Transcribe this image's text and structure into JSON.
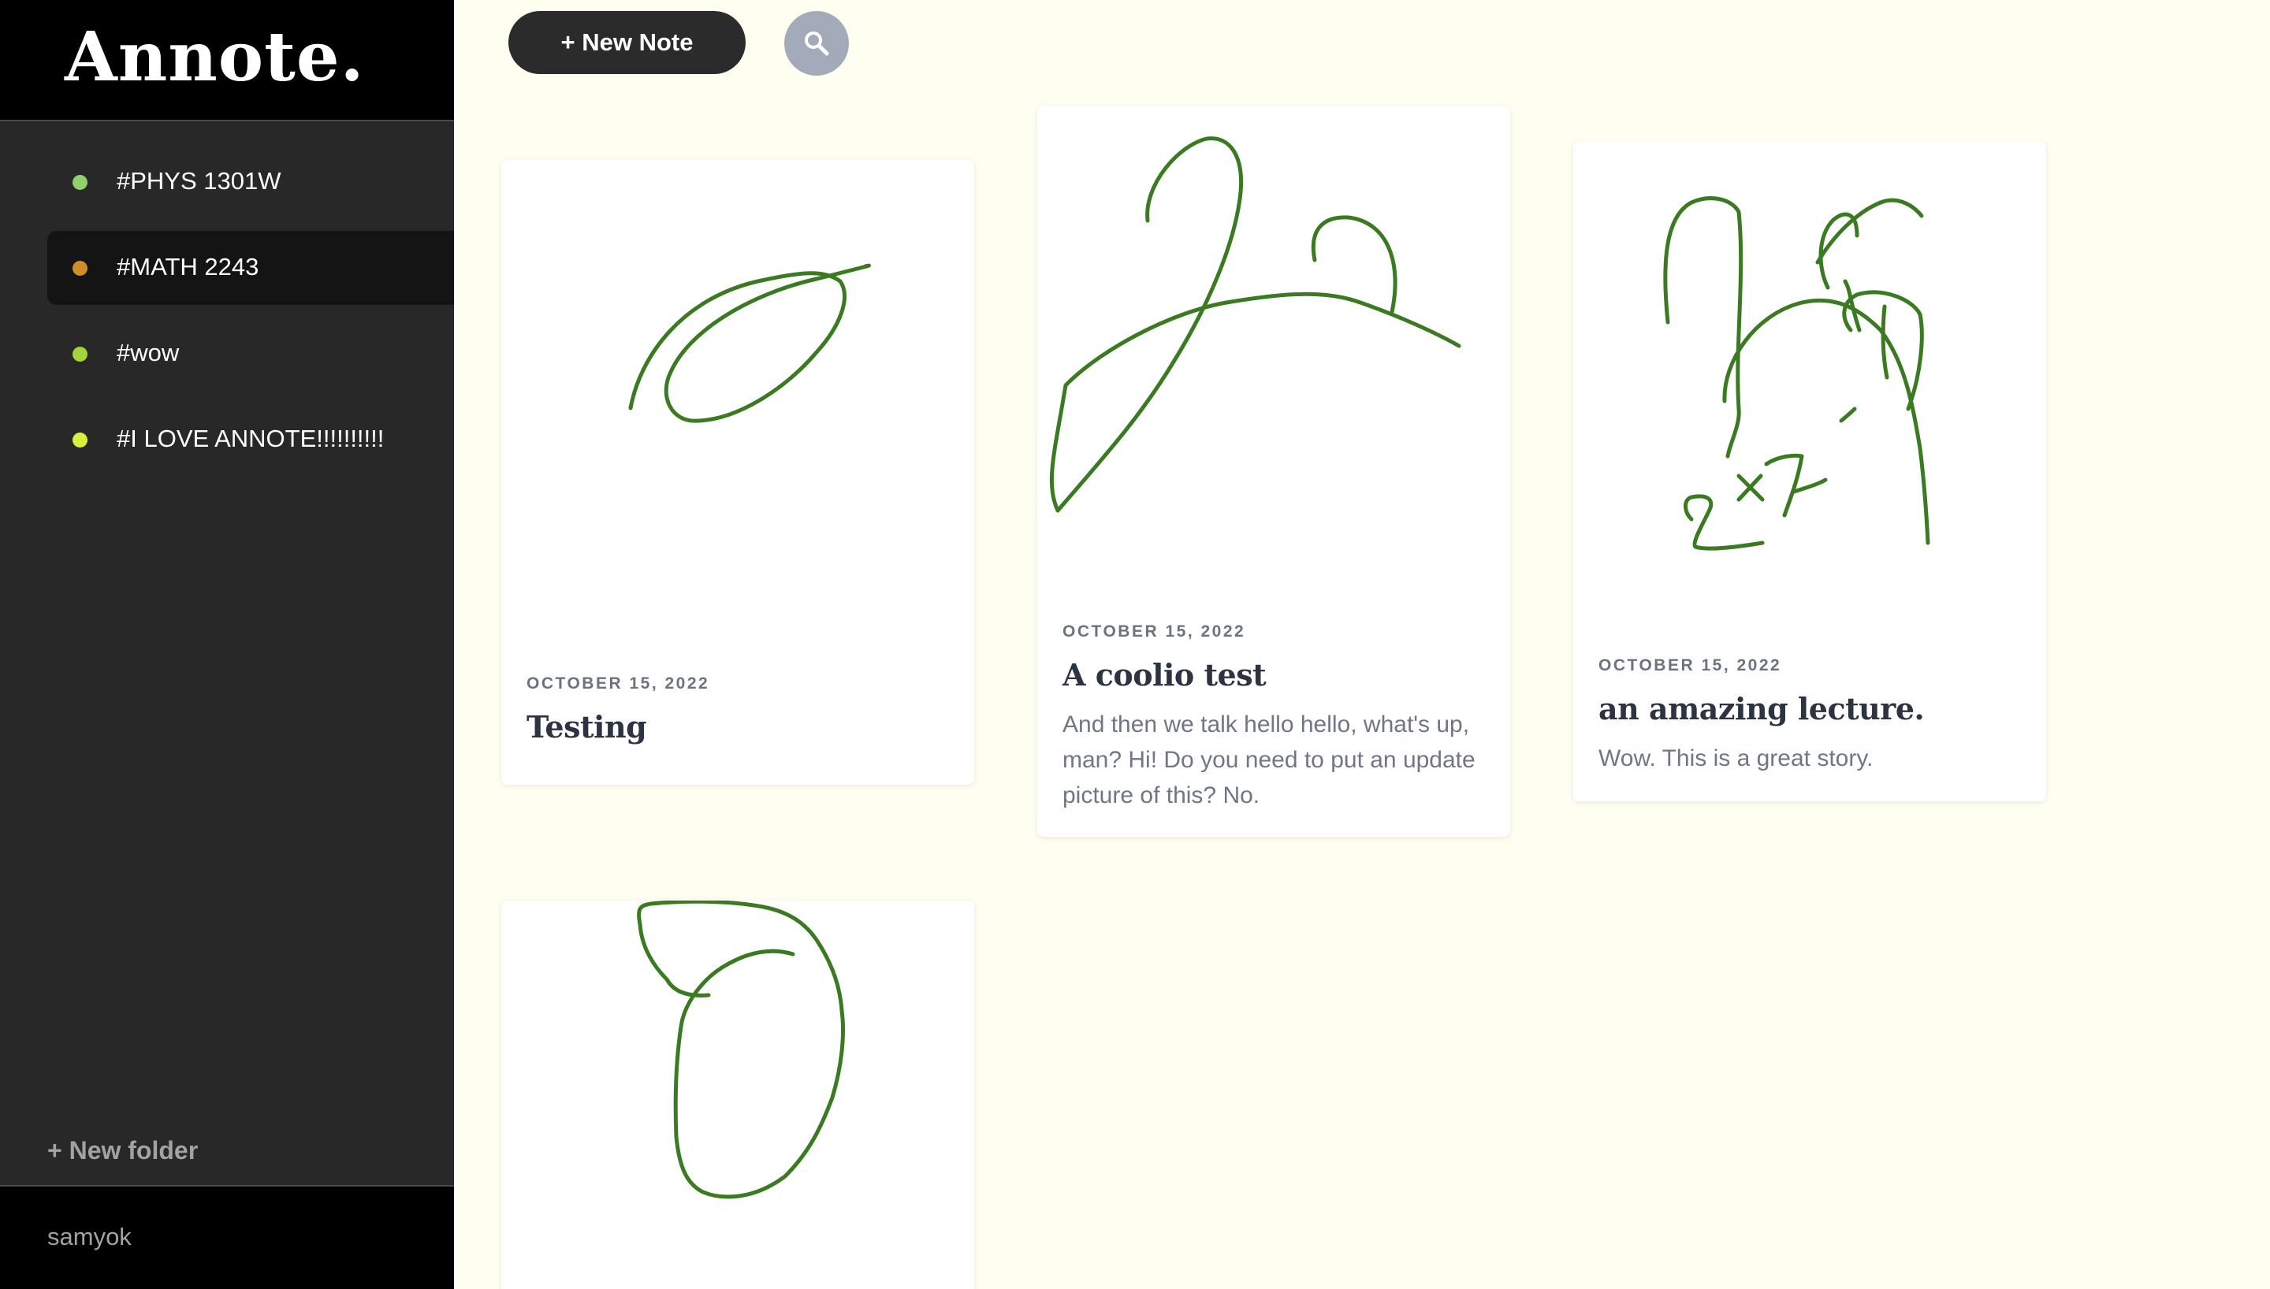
{
  "app": {
    "brand": "Annote.",
    "new_note_label": "+ New Note",
    "search_icon": "search-icon"
  },
  "sidebar": {
    "folders": [
      {
        "label": "#PHYS 1301W",
        "color": "#8fd26a",
        "active": false
      },
      {
        "label": "#MATH 2243",
        "color": "#cf8d28",
        "active": true
      },
      {
        "label": "#wow",
        "color": "#a3d43a",
        "active": false
      },
      {
        "label": "#I LOVE ANNOTE!!!!!!!!!!",
        "color": "#d8ef3b",
        "active": false
      }
    ],
    "new_folder_label": "+ New folder",
    "username": "samyok"
  },
  "notes": [
    {
      "date": "OCTOBER 15, 2022",
      "title": "Testing",
      "body": ""
    },
    {
      "date": "OCTOBER 15, 2022",
      "title": "A coolio test",
      "body": "And then we talk hello hello, what's up, man? Hi! Do you need to put an update picture of this? No."
    },
    {
      "date": "OCTOBER 15, 2022",
      "title": "an amazing lecture.",
      "body": "Wow. This is a great story."
    },
    {
      "date": "",
      "title": "",
      "body": ""
    }
  ],
  "colors": {
    "ink": "#3a7b22",
    "background": "#fffff1",
    "sidebar": "#282828"
  }
}
